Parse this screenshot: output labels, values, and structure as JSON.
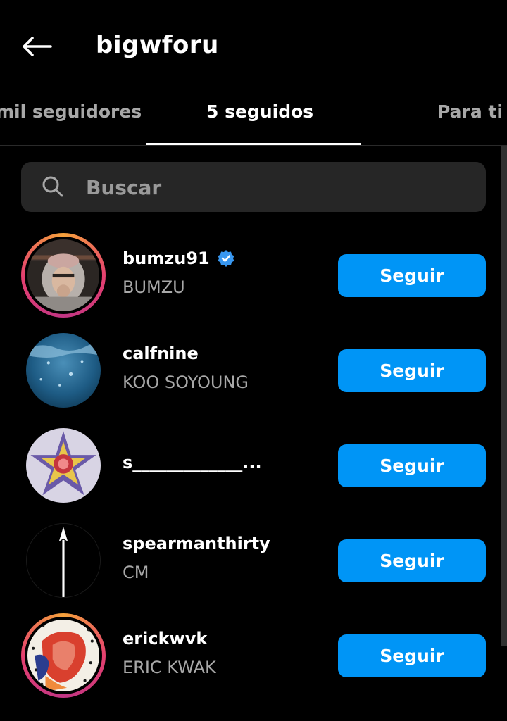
{
  "header": {
    "title": "bigwforu",
    "back_icon": "arrow-left-icon"
  },
  "tabs": [
    {
      "label": "mil seguidores"
    },
    {
      "label": "5 seguidos"
    },
    {
      "label": "Para ti"
    }
  ],
  "active_tab": 1,
  "search": {
    "placeholder": "Buscar",
    "value": ""
  },
  "users": [
    {
      "username": "bumzu91",
      "fullname": "BUMZU",
      "verified": true,
      "story_ring": true,
      "button": "Seguir"
    },
    {
      "username": "calfnine",
      "fullname": "KOO SOYOUNG",
      "verified": false,
      "story_ring": false,
      "button": "Seguir"
    },
    {
      "username": "s_____________...",
      "fullname": "",
      "verified": false,
      "story_ring": false,
      "button": "Seguir"
    },
    {
      "username": "spearmanthirty",
      "fullname": "CM",
      "verified": false,
      "story_ring": false,
      "button": "Seguir"
    },
    {
      "username": "erickwvk",
      "fullname": "ERIC KWAK",
      "verified": false,
      "story_ring": true,
      "button": "Seguir"
    }
  ],
  "colors": {
    "background": "#000000",
    "accent": "#0095f6",
    "secondary_text": "#a8a8a8",
    "search_bg": "#262626",
    "verified": "#3897f0"
  }
}
